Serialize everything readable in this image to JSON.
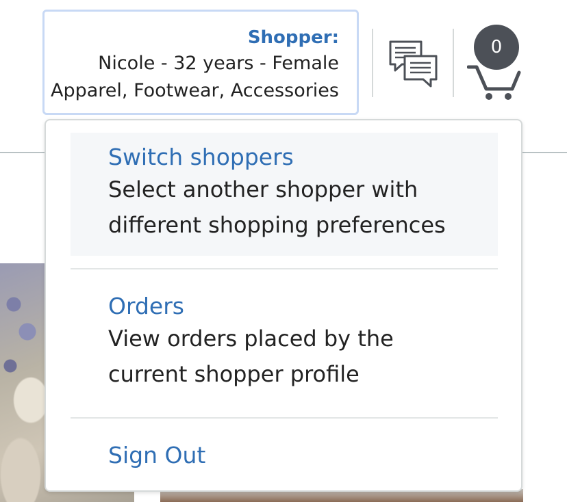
{
  "shopper": {
    "heading": "Shopper:",
    "profile": "Nicole - 32 years - Female",
    "interests": "Apparel, Footwear, Accessories"
  },
  "header": {
    "chat_icon": "chat-bubbles-icon",
    "cart_icon": "shopping-cart-icon",
    "cart_count": "0"
  },
  "menu": {
    "items": [
      {
        "title": "Switch shoppers",
        "description_line1": "Select another shopper with",
        "description_line2": "different shopping preferences"
      },
      {
        "title": "Orders",
        "description_line1": "View orders placed by the",
        "description_line2": "current shopper profile"
      },
      {
        "title": "Sign Out"
      }
    ]
  },
  "colors": {
    "link_blue": "#2f6eb4",
    "badge_gray": "#4c5057",
    "box_border": "#c8d9f5"
  }
}
